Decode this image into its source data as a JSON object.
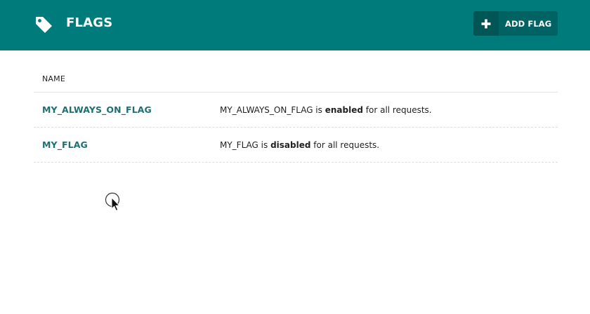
{
  "header": {
    "title": "FLAGS",
    "add_button_label": "ADD FLAG",
    "icon": "tag-icon",
    "background": "#007b7b"
  },
  "table": {
    "columns": [
      "NAME"
    ],
    "rows": [
      {
        "name": "MY_ALWAYS_ON_FLAG",
        "desc_prefix": "MY_ALWAYS_ON_FLAG is",
        "state": "enabled",
        "desc_suffix": "for all requests."
      },
      {
        "name": "MY_FLAG",
        "desc_prefix": "MY_FLAG is",
        "state": "disabled",
        "desc_suffix": "for all requests."
      }
    ]
  },
  "colors": {
    "accent": "#007b7b",
    "link": "#1f6f6f",
    "button": "#006262"
  }
}
